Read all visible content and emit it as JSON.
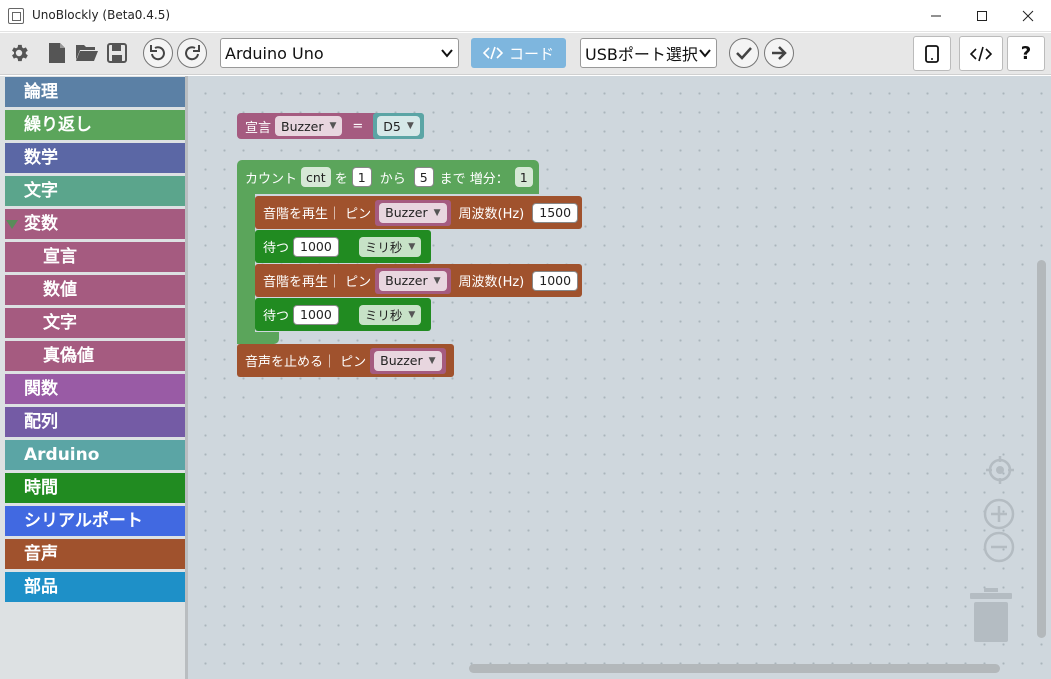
{
  "window": {
    "title": "UnoBlockly (Beta0.4.5)"
  },
  "toolbar": {
    "board_select": "Arduino Uno",
    "code_button": "コード",
    "port_select": "USBポート選択",
    "help_label": "?"
  },
  "sidebar": {
    "items": [
      {
        "label": "論理",
        "color": "#5b80a5"
      },
      {
        "label": "繰り返し",
        "color": "#5ba55b"
      },
      {
        "label": "数学",
        "color": "#5b67a5"
      },
      {
        "label": "文字",
        "color": "#5ba58c"
      },
      {
        "label": "変数",
        "color": "#a55b80"
      },
      {
        "label": "宣言",
        "color": "#a55b80"
      },
      {
        "label": "数値",
        "color": "#a55b80"
      },
      {
        "label": "文字",
        "color": "#a55b80"
      },
      {
        "label": "真偽値",
        "color": "#a55b80"
      },
      {
        "label": "関数",
        "color": "#995ba5"
      },
      {
        "label": "配列",
        "color": "#745ba5"
      },
      {
        "label": "Arduino",
        "color": "#5ba5a5"
      },
      {
        "label": "時間",
        "color": "#218b21"
      },
      {
        "label": "シリアルポート",
        "color": "#4169e1"
      },
      {
        "label": "音声",
        "color": "#a0522d"
      },
      {
        "label": "部品",
        "color": "#1e90c8"
      }
    ]
  },
  "blocks": {
    "declare": {
      "label": "宣言",
      "var_name": "Buzzer",
      "equals": "=",
      "pin": "D5"
    },
    "loop": {
      "label_count": "カウント",
      "var": "cnt",
      "label_wo": "を",
      "from_value": "1",
      "label_from": "から",
      "to_value": "5",
      "label_to": "まで 増分：",
      "step": "1"
    },
    "tone1": {
      "label": "音階を再生｜ ピン",
      "pin": "Buzzer",
      "label_freq": "周波数(Hz)",
      "freq": "1500"
    },
    "wait1": {
      "label": "待つ",
      "value": "1000",
      "unit": "ミリ秒"
    },
    "tone2": {
      "label": "音階を再生｜ ピン",
      "pin": "Buzzer",
      "label_freq": "周波数(Hz)",
      "freq": "1000"
    },
    "wait2": {
      "label": "待つ",
      "value": "1000",
      "unit": "ミリ秒"
    },
    "notone": {
      "label": "音声を止める｜ ピン",
      "pin": "Buzzer"
    }
  },
  "icons": {
    "settings": "gear-icon",
    "new": "new-file-icon",
    "open": "open-folder-icon",
    "save": "save-icon",
    "undo": "undo-icon",
    "redo": "redo-icon",
    "verify": "check-icon",
    "upload": "arrow-right-icon",
    "device": "tablet-icon",
    "code_view": "code-icon",
    "recenter": "crosshair-icon",
    "zoom_in": "zoom-in-icon",
    "zoom_out": "zoom-out-icon",
    "trash": "trash-icon"
  }
}
